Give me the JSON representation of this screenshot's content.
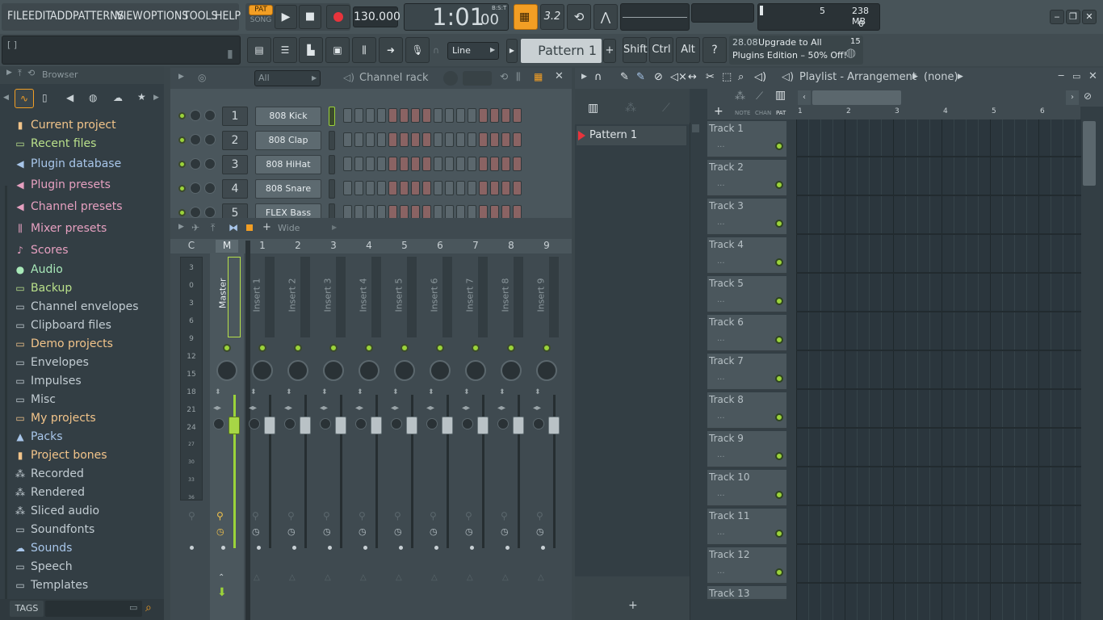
{
  "menu": [
    "FILE",
    "EDIT",
    "ADD",
    "PATTERNS",
    "VIEW",
    "OPTIONS",
    "TOOLS",
    "HELP"
  ],
  "transport": {
    "pat_label": "PAT",
    "song_label": "SONG",
    "tempo": "130.000",
    "time": "1:01",
    "time_sub": "00",
    "bst": "B:S:T"
  },
  "meters": {
    "cpu": "5",
    "ram": "238 MB",
    "voices": "0"
  },
  "toolbar2": {
    "hint": "[ ]",
    "snap": "Line",
    "pattern": "Pattern 1",
    "shift": "Shift",
    "ctrl": "Ctrl",
    "alt": "Alt",
    "news_date": "28.08",
    "news_line1": "Upgrade to All",
    "news_line2": "Plugins Edition – 50% Off!",
    "news_count": "15"
  },
  "browser": {
    "title": "Browser",
    "items": [
      {
        "label": "Current project",
        "color": "#f2c48a",
        "icon": "project-icon"
      },
      {
        "label": "Recent files",
        "color": "#b9e08a",
        "icon": "folder-icon"
      },
      {
        "label": "Plugin database",
        "color": "#a8c6ea",
        "icon": "plug-icon"
      },
      {
        "label": "Plugin presets",
        "color": "#e6a0c0",
        "icon": "plug-icon"
      },
      {
        "label": "Channel presets",
        "color": "#e6a0c0",
        "icon": "plug-icon"
      },
      {
        "label": "Mixer presets",
        "color": "#e6a0c0",
        "icon": "mixer-icon"
      },
      {
        "label": "Scores",
        "color": "#e6a0c0",
        "icon": "note-icon"
      },
      {
        "label": "Audio",
        "color": "#a8e8b8",
        "icon": "person-icon"
      },
      {
        "label": "Backup",
        "color": "#b9e08a",
        "icon": "folder-icon"
      },
      {
        "label": "Channel envelopes",
        "color": "#c2ccd2",
        "icon": "folder-icon"
      },
      {
        "label": "Clipboard files",
        "color": "#c2ccd2",
        "icon": "folder-icon"
      },
      {
        "label": "Demo projects",
        "color": "#f2c48a",
        "icon": "folder-icon"
      },
      {
        "label": "Envelopes",
        "color": "#c2ccd2",
        "icon": "folder-icon"
      },
      {
        "label": "Impulses",
        "color": "#c2ccd2",
        "icon": "folder-icon"
      },
      {
        "label": "Misc",
        "color": "#c2ccd2",
        "icon": "folder-icon"
      },
      {
        "label": "My projects",
        "color": "#f2c48a",
        "icon": "folder-icon"
      },
      {
        "label": "Packs",
        "color": "#a8c6ea",
        "icon": "pack-icon"
      },
      {
        "label": "Project bones",
        "color": "#f2c48a",
        "icon": "project-icon"
      },
      {
        "label": "Recorded",
        "color": "#c2ccd2",
        "icon": "wave-icon"
      },
      {
        "label": "Rendered",
        "color": "#c2ccd2",
        "icon": "wave-icon"
      },
      {
        "label": "Sliced audio",
        "color": "#c2ccd2",
        "icon": "wave-icon"
      },
      {
        "label": "Soundfonts",
        "color": "#c2ccd2",
        "icon": "folder-icon"
      },
      {
        "label": "Sounds",
        "color": "#a8c6ea",
        "icon": "cloud-icon"
      },
      {
        "label": "Speech",
        "color": "#c2ccd2",
        "icon": "folder-icon"
      },
      {
        "label": "Templates",
        "color": "#c2ccd2",
        "icon": "folder-icon"
      }
    ],
    "tags": "TAGS"
  },
  "channel_rack": {
    "filter": "All",
    "title": "Channel rack",
    "channels": [
      {
        "num": "1",
        "name": "808 Kick"
      },
      {
        "num": "2",
        "name": "808 Clap"
      },
      {
        "num": "3",
        "name": "808 HiHat"
      },
      {
        "num": "4",
        "name": "808 Snare"
      },
      {
        "num": "5",
        "name": "FLEX Bass"
      }
    ]
  },
  "mixer": {
    "view": "Wide",
    "head": [
      "C",
      "M",
      "1",
      "2",
      "3",
      "4",
      "5",
      "6",
      "7",
      "8",
      "9"
    ],
    "scale": [
      "3",
      "0",
      "3",
      "6",
      "9",
      "12",
      "15",
      "18",
      "21",
      "24",
      "27",
      "30",
      "33",
      "36"
    ],
    "tracks": [
      "Master",
      "Insert 1",
      "Insert 2",
      "Insert 3",
      "Insert 4",
      "Insert 5",
      "Insert 6",
      "Insert 7",
      "Insert 8",
      "Insert 9"
    ]
  },
  "playlist": {
    "title": "Playlist - Arrangement",
    "arrangement": "(none)",
    "patterns": [
      "Pattern 1"
    ],
    "mode_labels": [
      "NOTE",
      "CHAN",
      "PAT"
    ],
    "ruler": [
      "1",
      "2",
      "3",
      "4",
      "5",
      "6"
    ],
    "tracks": [
      "Track 1",
      "Track 2",
      "Track 3",
      "Track 4",
      "Track 5",
      "Track 6",
      "Track 7",
      "Track 8",
      "Track 9",
      "Track 10",
      "Track 11",
      "Track 12",
      "Track 13"
    ]
  }
}
